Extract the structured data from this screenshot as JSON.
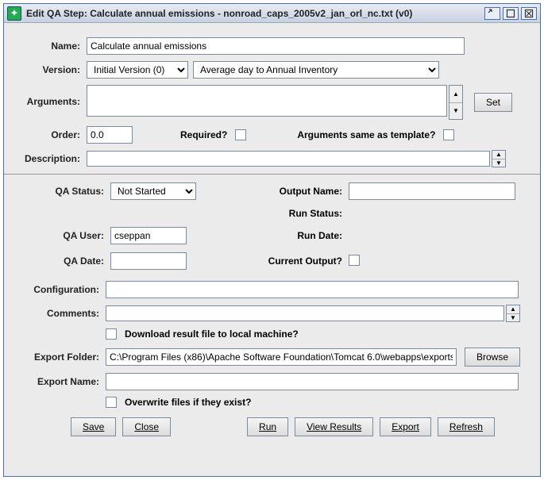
{
  "window": {
    "title": "Edit QA Step: Calculate annual emissions - nonroad_caps_2005v2_jan_orl_nc.txt (v0)"
  },
  "form": {
    "name_label": "Name:",
    "name_value": "Calculate annual emissions",
    "version_label": "Version:",
    "version_value": "Initial Version (0)",
    "method_value": "Average day to Annual Inventory",
    "arguments_label": "Arguments:",
    "arguments_value": "",
    "set_label": "Set",
    "order_label": "Order:",
    "order_value": "0.0",
    "required_label": "Required?",
    "args_template_label": "Arguments same as template?",
    "description_label": "Description:",
    "description_value": ""
  },
  "status": {
    "qa_status_label": "QA Status:",
    "qa_status_value": "Not Started",
    "qa_user_label": "QA User:",
    "qa_user_value": "cseppan",
    "qa_date_label": "QA Date:",
    "qa_date_value": "",
    "output_name_label": "Output Name:",
    "output_name_value": "",
    "run_status_label": "Run Status:",
    "run_status_value": "",
    "run_date_label": "Run Date:",
    "run_date_value": "",
    "current_output_label": "Current Output?"
  },
  "config": {
    "configuration_label": "Configuration:",
    "configuration_value": "",
    "comments_label": "Comments:",
    "comments_value": "",
    "download_label": "Download result file to local machine?",
    "export_folder_label": "Export Folder:",
    "export_folder_value": "C:\\Program Files (x86)\\Apache Software Foundation\\Tomcat 6.0\\webapps\\exports",
    "browse_label": "Browse",
    "export_name_label": "Export Name:",
    "export_name_value": "",
    "overwrite_label": "Overwrite files if they exist?"
  },
  "buttons": {
    "save": "Save",
    "close": "Close",
    "run": "Run",
    "view_results": "View Results",
    "export": "Export",
    "refresh": "Refresh"
  }
}
